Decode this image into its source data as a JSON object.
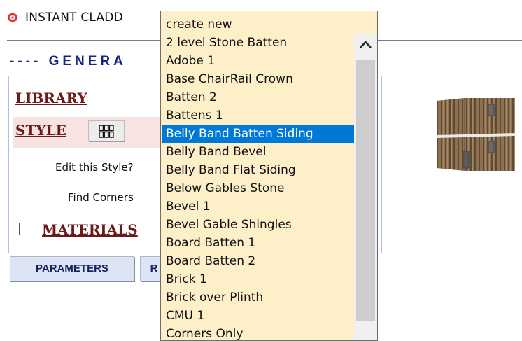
{
  "app": {
    "title": "INSTANT CLADD"
  },
  "general": {
    "header": "---- GENERA"
  },
  "library": {
    "label": "LIBRARY"
  },
  "style": {
    "label": "STYLE",
    "edit_label": "Edit this Style?",
    "find_corners_label": "Find Corners"
  },
  "materials": {
    "label": "MATERIALS",
    "checked": false
  },
  "tabs": {
    "parameters": "PARAMETERS",
    "second": "R"
  },
  "dropdown": {
    "selected": "Belly Band Batten Siding",
    "options": [
      "create new",
      "2 level Stone Batten",
      "Adobe 1",
      "Base ChairRail Crown",
      "Batten 2",
      "Battens 1",
      "Belly Band Batten Siding",
      "Belly Band Bevel",
      "Belly Band Flat Siding",
      "Below Gables Stone",
      "Bevel 1",
      "Bevel Gable Shingles",
      "Board Batten 1",
      "Board Batten 2",
      "Brick 1",
      "Brick over Plinth",
      "CMU 1",
      "Corners Only"
    ]
  },
  "colors": {
    "link": "#6b1a1a",
    "section_header": "#1a237e",
    "dropdown_bg": "#fdf0c8",
    "selection": "#0078d7",
    "button_bg": "#dde5f4"
  }
}
